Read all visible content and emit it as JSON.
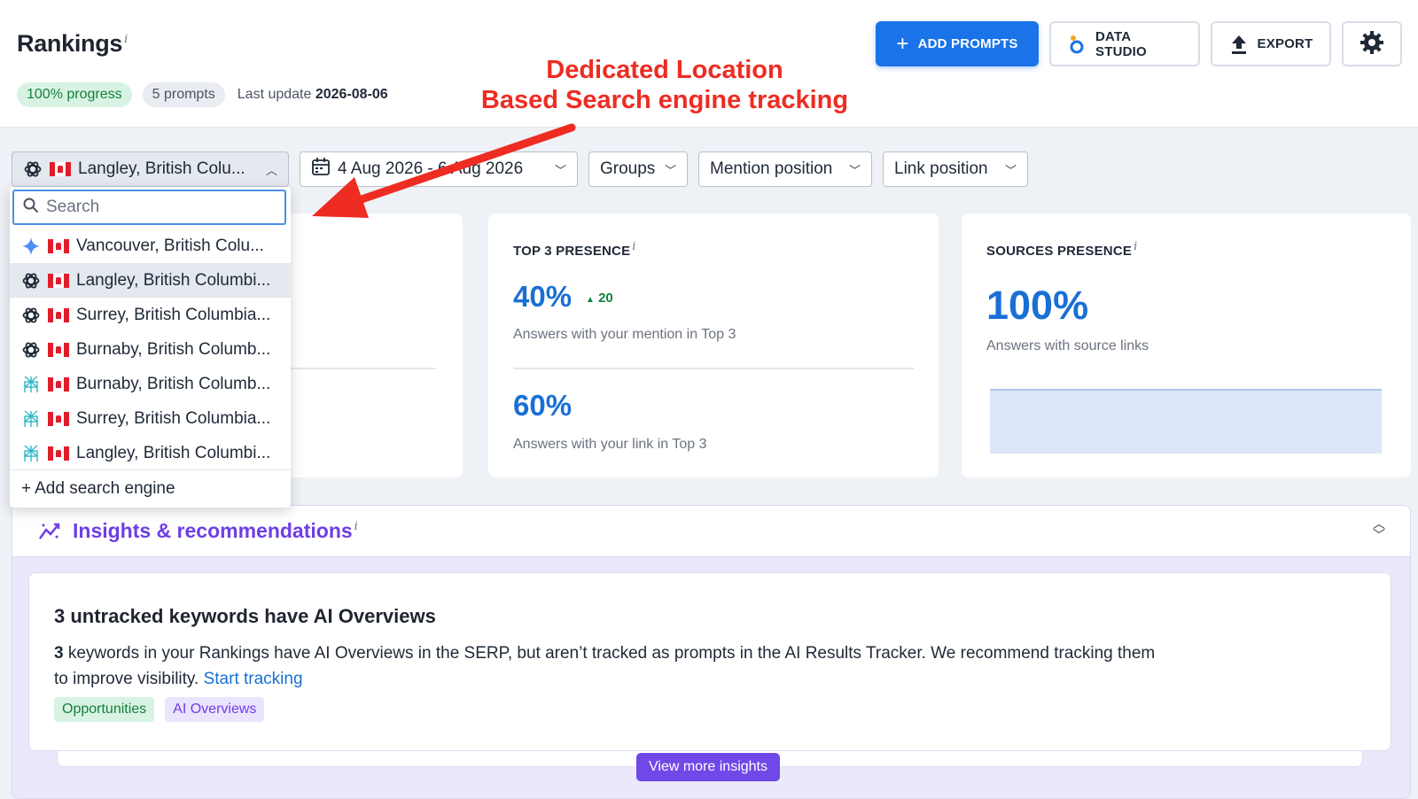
{
  "header": {
    "title": "Rankings",
    "info_mark": "i",
    "progress_badge": "100% progress",
    "prompts_badge": "5 prompts",
    "last_update_label": "Last update",
    "last_update_value": "2026-08-06"
  },
  "actions": {
    "add_prompts": "ADD PROMPTS",
    "data_studio": "DATA STUDIO",
    "export": "EXPORT"
  },
  "annotation": {
    "line1": "Dedicated Location",
    "line2": "Based Search engine tracking"
  },
  "filters": {
    "engine_selected": "Langley, British Colu...",
    "date_range": "4 Aug 2026 - 6 Aug 2026",
    "groups": "Groups",
    "mention_position": "Mention position",
    "link_position": "Link position"
  },
  "dropdown": {
    "search_placeholder": "Search",
    "items": [
      {
        "label": "Vancouver, British Colu...",
        "engine": "gemini-icon"
      },
      {
        "label": "Langley, British Columbi...",
        "engine": "chatgpt-icon"
      },
      {
        "label": "Surrey, British Columbia...",
        "engine": "chatgpt-icon"
      },
      {
        "label": "Burnaby, British Columb...",
        "engine": "chatgpt-icon"
      },
      {
        "label": "Burnaby, British Columb...",
        "engine": "perplexity-icon"
      },
      {
        "label": "Surrey, British Columbia...",
        "engine": "perplexity-icon"
      },
      {
        "label": "Langley, British Columbi...",
        "engine": "perplexity-icon"
      }
    ],
    "add_engine": "Add search engine"
  },
  "cards": {
    "top3": {
      "title": "TOP 3 PRESENCE",
      "mention_value": "40%",
      "mention_delta": "20",
      "mention_text": "Answers with your mention in Top 3",
      "link_value": "60%",
      "link_text": "Answers with your link in Top 3"
    },
    "sources": {
      "title": "SOURCES PRESENCE",
      "value": "100%",
      "text": "Answers with source links"
    }
  },
  "insights": {
    "title": "Insights & recommendations",
    "card_title": "3 untracked keywords have AI Overviews",
    "card_count": "3",
    "card_text": " keywords in your Rankings have AI Overviews in the SERP, but aren’t tracked as prompts in the AI Results Tracker. We recommend tracking them to improve visibility. ",
    "card_link": "Start tracking",
    "tags": [
      "Opportunities",
      "AI Overviews"
    ],
    "view_more": "View more insights"
  },
  "colors": {
    "primary": "#1a73e8",
    "annotation": "#ee2c22",
    "insights_purple": "#6d3ee6",
    "positive": "#15803d"
  }
}
